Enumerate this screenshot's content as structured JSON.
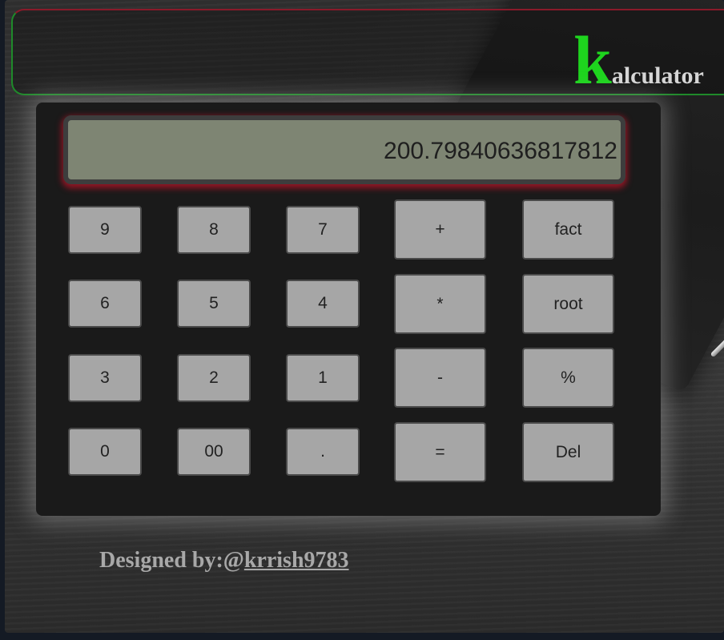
{
  "header": {
    "brand_initial": "k",
    "brand_rest": "alculator"
  },
  "display": {
    "value": "200.79840636817812"
  },
  "keypad": {
    "digits": [
      "9",
      "8",
      "7",
      "6",
      "5",
      "4",
      "3",
      "2",
      "1",
      "0",
      "00",
      "."
    ],
    "operators": [
      "+",
      "*",
      "-",
      "="
    ],
    "functions": [
      "fact",
      "root",
      "%",
      "Del"
    ]
  },
  "footer": {
    "prefix": "Designed by:@",
    "author_link": "krrish9783"
  },
  "colors": {
    "brand_green": "#1ed41e",
    "display_bg": "#7e8573",
    "button_bg": "#a6a6a6",
    "display_glow": "#be1428"
  }
}
